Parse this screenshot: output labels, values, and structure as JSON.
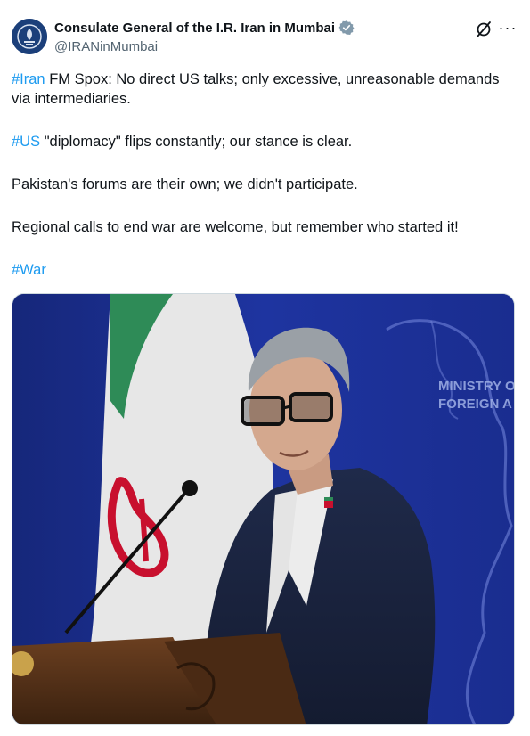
{
  "post": {
    "author": {
      "display_name": "Consulate General of the I.R. Iran in Mumbai",
      "handle": "@IRANinMumbai",
      "verified": true,
      "avatar_icon": "emblem-avatar-icon"
    },
    "actions": {
      "grok_icon": "grok-icon",
      "more_icon": "more-icon",
      "more_label": "···"
    },
    "paragraphs": [
      {
        "hashtag": "#Iran",
        "text": " FM Spox: No direct US talks; only excessive, unreasonable demands via intermediaries."
      },
      {
        "hashtag": "#US",
        "text": " \"diplomacy\" flips constantly; our stance is clear."
      },
      {
        "hashtag": "",
        "text": "Pakistan's forums are their own; we didn't participate."
      },
      {
        "hashtag": "",
        "text": "Regional calls to end war are welcome, but remember who started it!"
      },
      {
        "hashtag": "#War",
        "text": ""
      }
    ],
    "media": {
      "backdrop_text_line1": "MINISTRY OF",
      "backdrop_text_line2": "FOREIGN A"
    },
    "colors": {
      "link": "#1d9bf0",
      "text": "#0f1419",
      "secondary": "#536471",
      "backdrop_blue": "#1b2f8a"
    }
  }
}
